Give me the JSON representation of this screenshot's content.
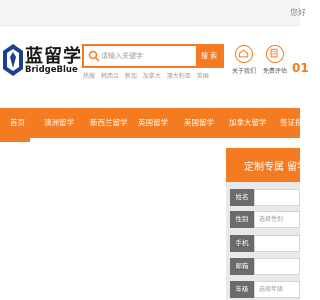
{
  "topbar": {
    "text": "您好"
  },
  "logo": {
    "cn": "蓝留学",
    "en": "BridgeBlue"
  },
  "search": {
    "placeholder": "请输入关键字",
    "button": "搜 索"
  },
  "hot_links": [
    "热搜",
    "韩西兰",
    "新加",
    "加拿大",
    "澳大利亚",
    "英国"
  ],
  "actions": [
    {
      "label": "关于我们",
      "icon": "info-icon"
    },
    {
      "label": "免费评估",
      "icon": "assessment-icon"
    }
  ],
  "phone_partial": "01",
  "nav": [
    "首页",
    "澳洲留学",
    "新西兰留学",
    "英国留学",
    "美国留学",
    "加拿大留学",
    "签证指南"
  ],
  "panel": {
    "title": "定制专属 留学方",
    "fields": [
      {
        "label": "姓名",
        "placeholder": ""
      },
      {
        "label": "性别",
        "placeholder": "选择性别"
      },
      {
        "label": "手机",
        "placeholder": ""
      },
      {
        "label": "邮箱",
        "placeholder": ""
      },
      {
        "label": "年级",
        "placeholder": "选择年级"
      }
    ]
  },
  "colors": {
    "accent": "#f47b20",
    "label_bg": "#6b6b6b",
    "panel_bg": "#e9e9e9"
  }
}
